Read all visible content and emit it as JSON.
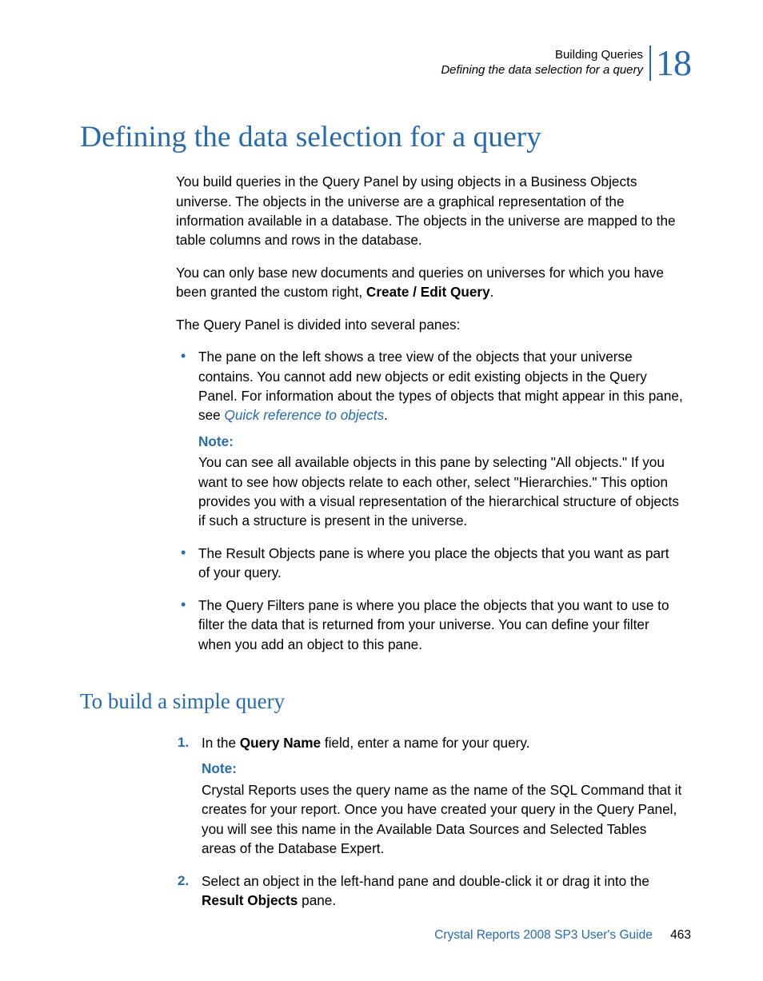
{
  "header": {
    "line1": "Building Queries",
    "line2": "Defining the data selection for a query",
    "chapter_number": "18"
  },
  "headings": {
    "h1": "Defining the data selection for a query",
    "h2": "To build a simple query"
  },
  "paragraphs": {
    "p1": "You build queries in the Query Panel by using objects in a Business Objects universe. The objects in the universe are a graphical representation of the information available in a database. The objects in the universe are mapped to the table columns and rows in the database.",
    "p2_a": "You can only base new documents and queries on universes for which you have been granted the custom right, ",
    "p2_bold": "Create / Edit Query",
    "p2_b": ".",
    "p3": "The Query Panel is divided into several panes:"
  },
  "bullets": {
    "b1_a": "The pane on the left shows a tree view of the objects that your universe contains. You cannot add new objects or edit existing objects in the Query Panel. For information about the types of objects that might appear in this pane, see ",
    "b1_link": "Quick reference to objects",
    "b1_c": ".",
    "note_label": "Note:",
    "b1_note": "You can see all available objects in this pane by selecting \"All objects.\" If you want to see how objects relate to each other, select \"Hierarchies.\" This option provides you with a visual representation of the hierarchical structure of objects if such a structure is present in the universe.",
    "b2": "The Result Objects pane is where you place the objects that you want as part of your query.",
    "b3": "The Query Filters pane is where you place the objects that you want to use to filter the data that is returned from your universe. You can define your filter when you add an object to this pane."
  },
  "steps": {
    "s1_a": "In the ",
    "s1_bold": "Query Name",
    "s1_b": " field, enter a name for your query.",
    "s1_note": "Crystal Reports uses the query name as the name of the SQL Command that it creates for your report. Once you have created your query in the Query Panel, you will see this name in the Available Data Sources and Selected Tables areas of the Database Expert.",
    "s2_a": "Select an object in the left-hand pane and double-click it or drag it into the ",
    "s2_bold": "Result Objects",
    "s2_b": " pane."
  },
  "footer": {
    "title": "Crystal Reports 2008 SP3 User's Guide",
    "page": "463"
  }
}
